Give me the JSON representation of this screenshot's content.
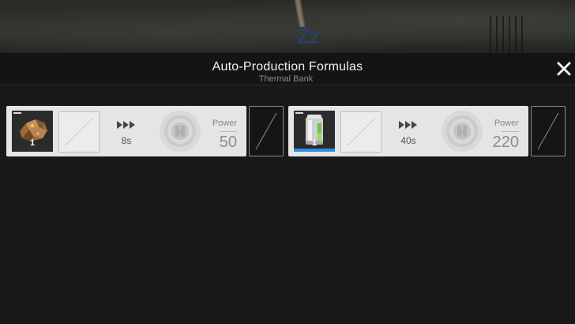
{
  "header": {
    "title": "Auto-Production Formulas",
    "subtitle": "Thermal Bank",
    "close_icon": "close-icon"
  },
  "formulas": [
    {
      "input_icon": "ore-icon",
      "input_quantity": "1",
      "time": "8s",
      "power_label": "Power",
      "power_value": "50",
      "rarity_color": "#2b2b2b"
    },
    {
      "input_icon": "battery-icon",
      "input_quantity": "1",
      "time": "40s",
      "power_label": "Power",
      "power_value": "220",
      "rarity_color": "#2e8ee0"
    }
  ],
  "colors": {
    "panel_bg": "#181818",
    "card_bg": "#e5e5e5",
    "text_light": "#f2f2f2",
    "text_muted": "#8e8e8e"
  }
}
